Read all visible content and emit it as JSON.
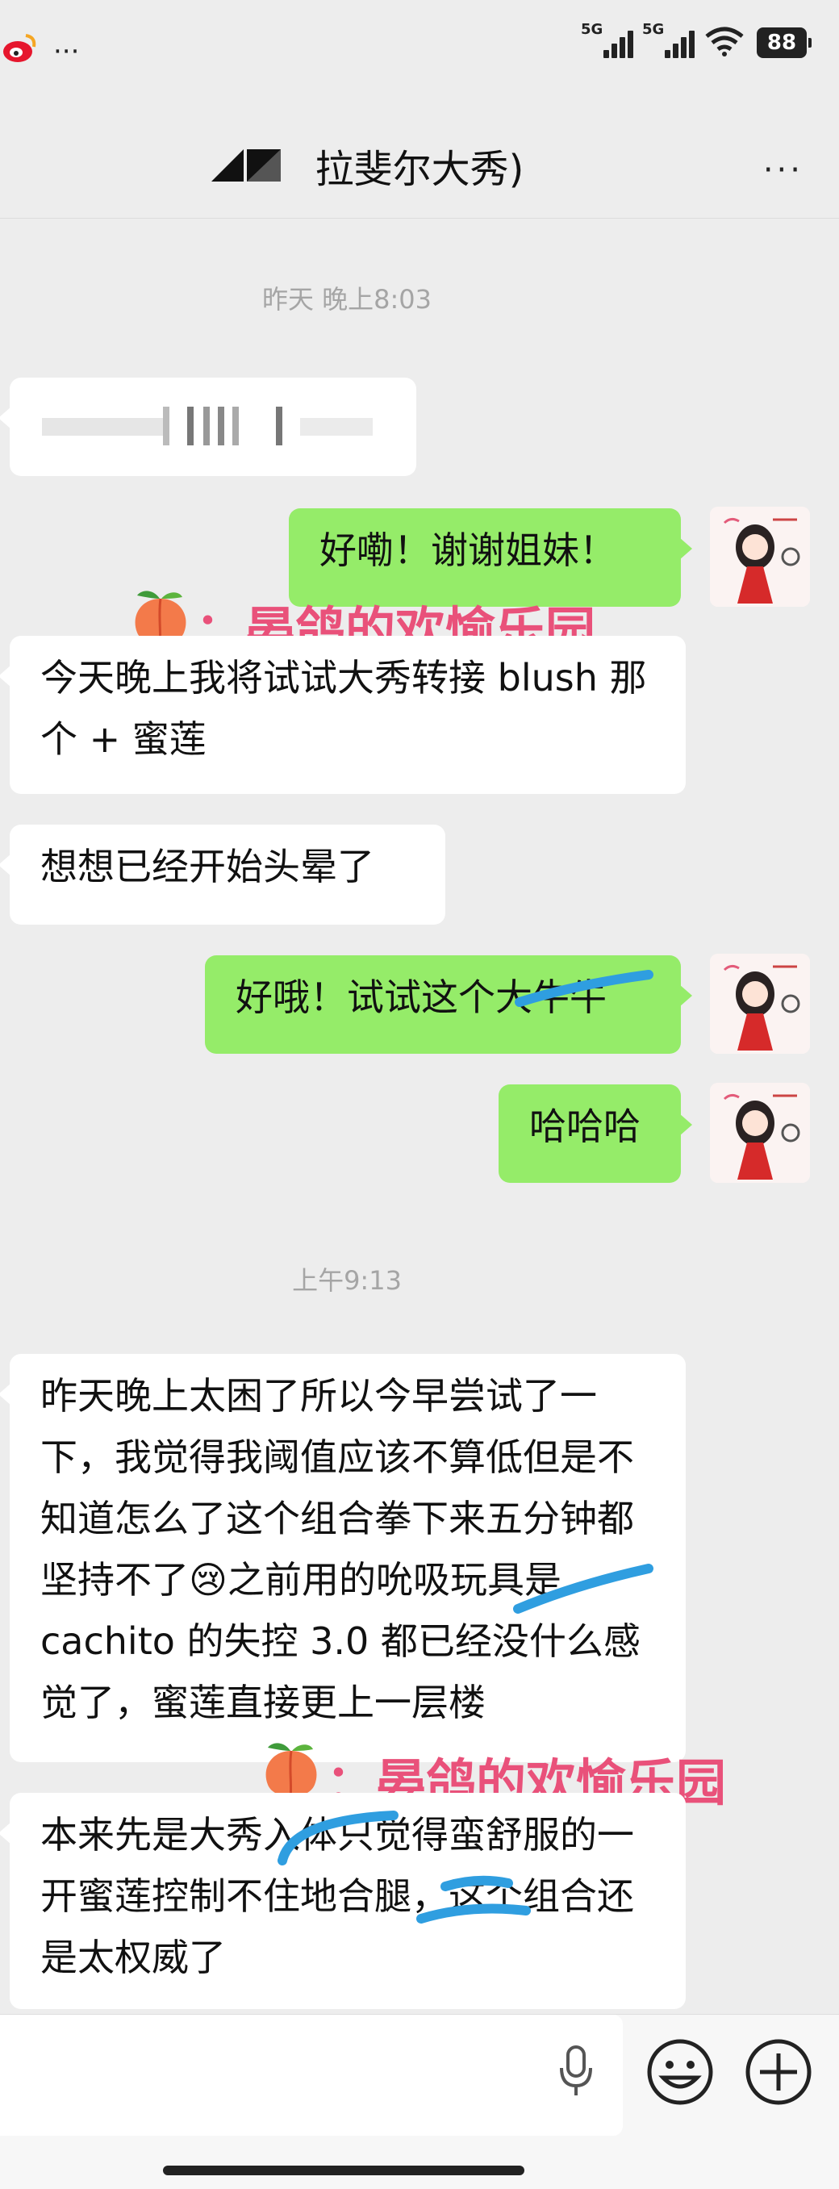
{
  "status_bar": {
    "left_icons": [
      "weibo-icon",
      "more-dots-icon"
    ],
    "signal_1_label": "5G",
    "signal_2_label": "5G",
    "battery": "88"
  },
  "nav": {
    "title": "拉斐尔大秀)",
    "more_label": "···"
  },
  "messages": [
    {
      "type": "time",
      "text": "昨天 晚上8:03"
    },
    {
      "type": "in",
      "text": "▌▌▌▌ ▌",
      "blurred": true
    },
    {
      "type": "out",
      "text": "好嘞！谢谢姐妹！"
    },
    {
      "type": "in",
      "text": "今天晚上我将试试大秀转接 blush 那个 + 蜜莲"
    },
    {
      "type": "in",
      "text": "想想已经开始头晕了"
    },
    {
      "type": "out",
      "text": "好哦！试试这个大牛牛"
    },
    {
      "type": "out",
      "text": "哈哈哈"
    },
    {
      "type": "time",
      "text": "上午9:13"
    },
    {
      "type": "in",
      "text": "昨天晚上太困了所以今早尝试了一下，我觉得我阈值应该不算低但是不知道怎么了这个组合拳下来五分钟都坚持不了😢之前用的吮吸玩具是 cachito 的失控 3.0 都已经没什么感觉了，蜜莲直接更上一层楼"
    },
    {
      "type": "in",
      "text": "本来先是大秀入体只觉得蛮舒服的一开蜜莲控制不住地合腿，这个组合还是太权威了"
    }
  ],
  "watermark": {
    "text": "：晏鸽的欢愉乐园",
    "icon": "peach-icon"
  },
  "colors": {
    "background": "#ededed",
    "outgoing_bubble": "#95ec69",
    "incoming_bubble": "#ffffff",
    "watermark": "#e9517a",
    "scribble": "#2f9ee0"
  },
  "input_bar": {
    "icons": [
      "microphone-icon",
      "emoji-icon",
      "add-icon"
    ]
  }
}
